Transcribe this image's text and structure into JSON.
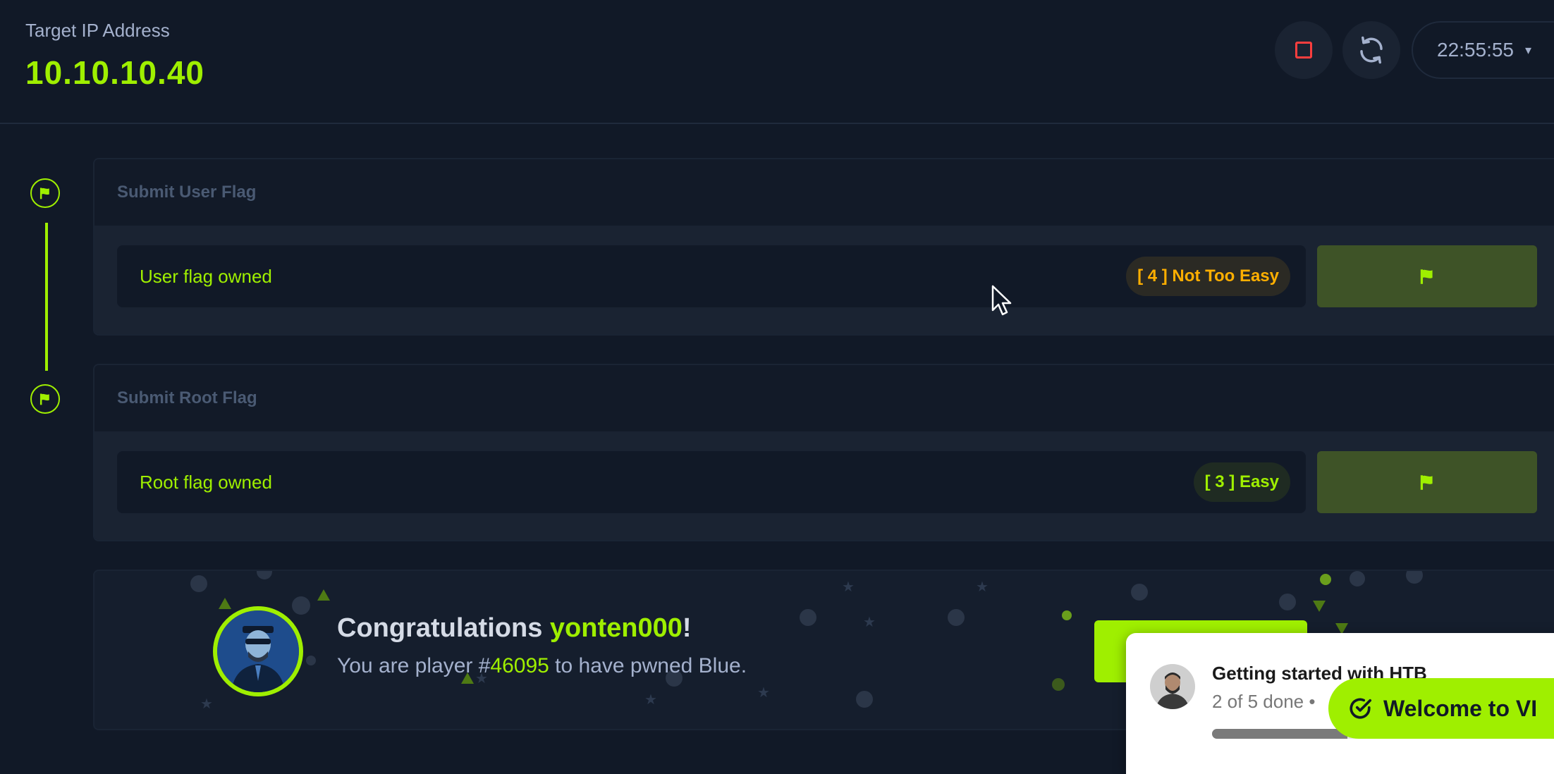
{
  "header": {
    "ip_label": "Target IP Address",
    "ip_value": "10.10.10.40",
    "timer": "22:55:55",
    "stop_icon": "stop-square-icon",
    "refresh_icon": "refresh-icon",
    "colors": {
      "accent": "#9fef00",
      "stop": "#ff3e3e",
      "background": "#111927"
    }
  },
  "tasks": [
    {
      "title": "Submit User Flag",
      "answer": "User flag owned",
      "difficulty": "[ 4 ] Not Too Easy",
      "difficulty_color": "#ffaf00"
    },
    {
      "title": "Submit Root Flag",
      "answer": "Root flag owned",
      "difficulty": "[ 3 ] Easy",
      "difficulty_color": "#9fef00"
    }
  ],
  "congrats": {
    "title_prefix": "Congratulations ",
    "username": "yonten000",
    "title_suffix": "!",
    "sub_prefix": "You are player #",
    "player_number": "46095",
    "sub_suffix": " to have pwned Blue."
  },
  "getting_started": {
    "title": "Getting started with HTB",
    "progress_text": "2 of 5 done •",
    "progress_fraction": 0.4
  },
  "welcome_pill": {
    "label": "Welcome to VI"
  }
}
